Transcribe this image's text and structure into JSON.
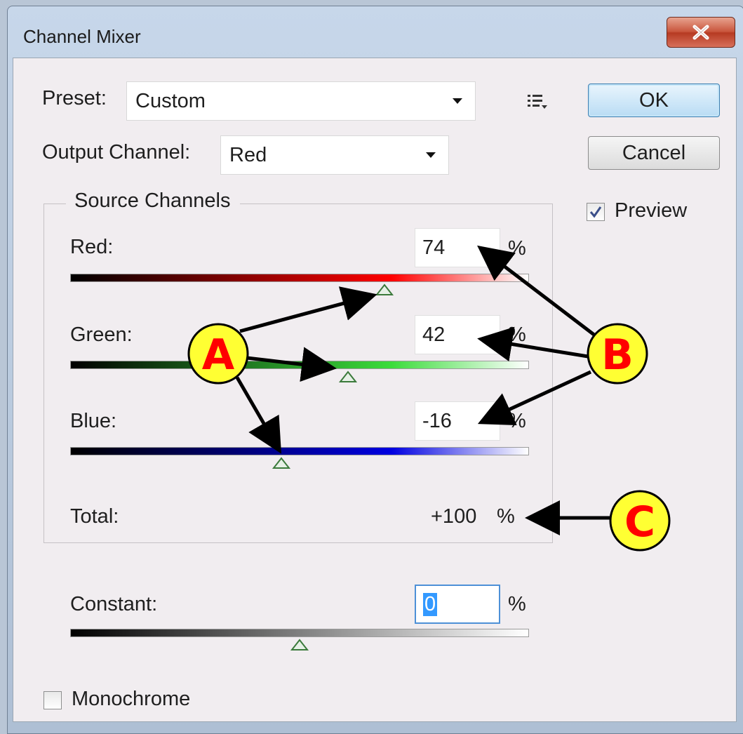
{
  "dialog": {
    "title": "Channel Mixer",
    "close_symbol": "×"
  },
  "preset": {
    "label": "Preset:",
    "value": "Custom"
  },
  "output_channel": {
    "label": "Output Channel:",
    "value": "Red"
  },
  "buttons": {
    "ok": "OK",
    "cancel": "Cancel"
  },
  "preview": {
    "label": "Preview",
    "checked": true
  },
  "source_channels": {
    "title": "Source Channels",
    "channels": [
      {
        "name": "Red:",
        "value": "74",
        "unit": "%",
        "level": 74,
        "gradient_color": "#ff0000",
        "end_color": "#ffffff"
      },
      {
        "name": "Green:",
        "value": "42",
        "unit": "%",
        "level": 42,
        "gradient_color": "#3bdc3b",
        "end_color": "#ffffff"
      },
      {
        "name": "Blue:",
        "value": "-16",
        "unit": "%",
        "level": -16,
        "gradient_color": "#0000e0",
        "end_color": "#ffffff"
      }
    ],
    "total_label": "Total:",
    "total_value": "+100",
    "total_unit": "%"
  },
  "constant": {
    "label": "Constant:",
    "value": "0",
    "unit": "%",
    "level": 0
  },
  "monochrome": {
    "label": "Monochrome",
    "checked": false
  },
  "annotations": {
    "A": "A",
    "B": "B",
    "C": "C",
    "badge_fill": "#ffff33",
    "badge_text_color": "#ff0000"
  },
  "icons": {
    "menu": "list-menu-icon",
    "check": "checkmark-icon",
    "close": "close-icon",
    "dropdown": "chevron-down-icon",
    "slider": "slider-thumb-icon"
  }
}
